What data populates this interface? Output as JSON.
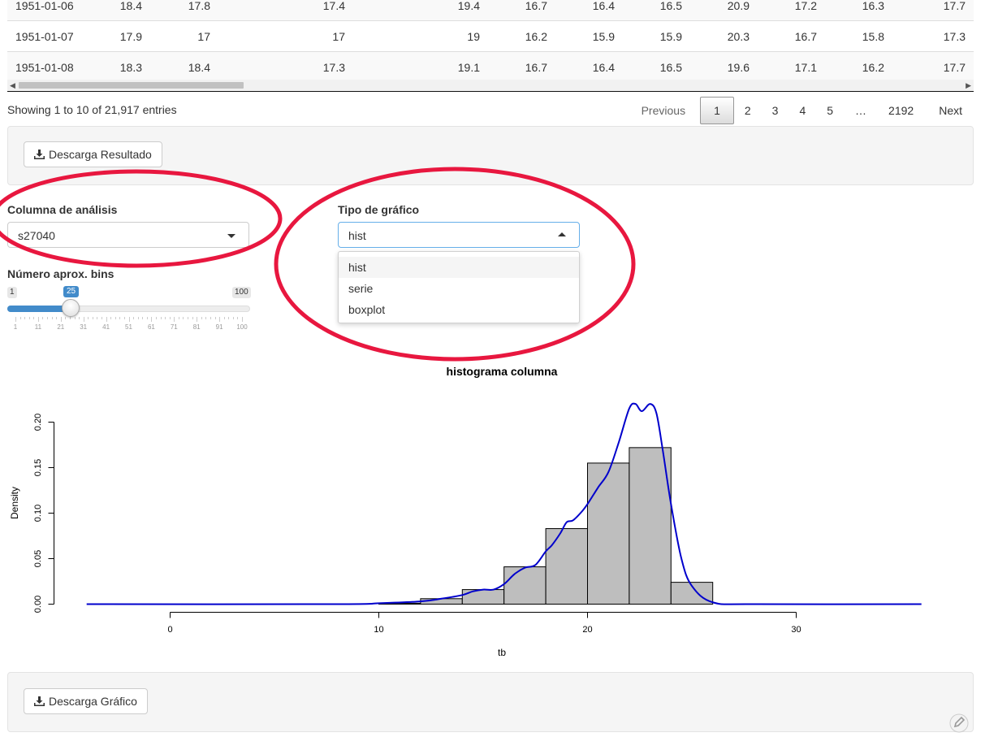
{
  "table": {
    "rows": [
      [
        "1951-01-06",
        "18.4",
        "17.8",
        "17.4",
        "19.4",
        "16.7",
        "16.4",
        "16.5",
        "20.9",
        "17.2",
        "16.3",
        "17.7"
      ],
      [
        "1951-01-07",
        "17.9",
        "17",
        "17",
        "19",
        "16.2",
        "15.9",
        "15.9",
        "20.3",
        "16.7",
        "15.8",
        "17.3"
      ],
      [
        "1951-01-08",
        "18.3",
        "18.4",
        "17.3",
        "19.1",
        "16.7",
        "16.4",
        "16.5",
        "19.6",
        "17.1",
        "16.2",
        "17.7"
      ]
    ],
    "info": "Showing 1 to 10 of 21,917 entries"
  },
  "pagination": {
    "previous": "Previous",
    "pages": [
      "1",
      "2",
      "3",
      "4",
      "5"
    ],
    "ellipsis": "…",
    "last": "2192",
    "next": "Next",
    "active": "1"
  },
  "download_result_label": "Descarga Resultado",
  "download_chart_label": "Descarga Gráfico",
  "column_select": {
    "label": "Columna de análisis",
    "value": "s27040"
  },
  "chart_type_select": {
    "label": "Tipo de gráfico",
    "value": "hist",
    "options": [
      "hist",
      "serie",
      "boxplot"
    ]
  },
  "bins_slider": {
    "label": "Número aprox. bins",
    "min": "1",
    "max": "100",
    "value": "25",
    "value_fraction": 0.2424,
    "ticks": [
      "1",
      "11",
      "21",
      "31",
      "41",
      "51",
      "61",
      "71",
      "81",
      "91",
      "100"
    ]
  },
  "annotation_color": "#e8173f",
  "accent_color": "#428bca",
  "chart_data": {
    "type": "bar",
    "title": "histograma columna",
    "xlabel": "tb",
    "ylabel": "Density",
    "xlim": [
      -4,
      36
    ],
    "ylim": [
      0,
      0.22
    ],
    "xticks": [
      "0",
      "10",
      "20",
      "30"
    ],
    "yticks": [
      "0.00",
      "0.05",
      "0.10",
      "0.15",
      "0.20"
    ],
    "bar_fill": "#bebebe",
    "bins": [
      {
        "x0": 10,
        "x1": 12,
        "density": 0.001
      },
      {
        "x0": 12,
        "x1": 14,
        "density": 0.006
      },
      {
        "x0": 14,
        "x1": 16,
        "density": 0.016
      },
      {
        "x0": 16,
        "x1": 18,
        "density": 0.041
      },
      {
        "x0": 18,
        "x1": 20,
        "density": 0.083
      },
      {
        "x0": 20,
        "x1": 22,
        "density": 0.155
      },
      {
        "x0": 22,
        "x1": 24,
        "density": 0.172
      },
      {
        "x0": 24,
        "x1": 26,
        "density": 0.024
      }
    ],
    "density_curve": {
      "color": "#0000cc",
      "x": [
        -4,
        8,
        10,
        12,
        13,
        14,
        14.5,
        15,
        15.5,
        16,
        16.5,
        17,
        17.5,
        18,
        18.3,
        18.7,
        19,
        19.3,
        19.7,
        20,
        20.5,
        21,
        21.5,
        22,
        22.3,
        22.6,
        23,
        23.3,
        23.6,
        24,
        24.5,
        25,
        26,
        28,
        36
      ],
      "y": [
        0,
        0,
        0.001,
        0.003,
        0.006,
        0.01,
        0.014,
        0.016,
        0.016,
        0.022,
        0.033,
        0.04,
        0.043,
        0.058,
        0.065,
        0.078,
        0.09,
        0.092,
        0.101,
        0.11,
        0.128,
        0.145,
        0.178,
        0.215,
        0.22,
        0.212,
        0.22,
        0.21,
        0.17,
        0.11,
        0.05,
        0.02,
        0.002,
        0,
        0
      ]
    }
  }
}
